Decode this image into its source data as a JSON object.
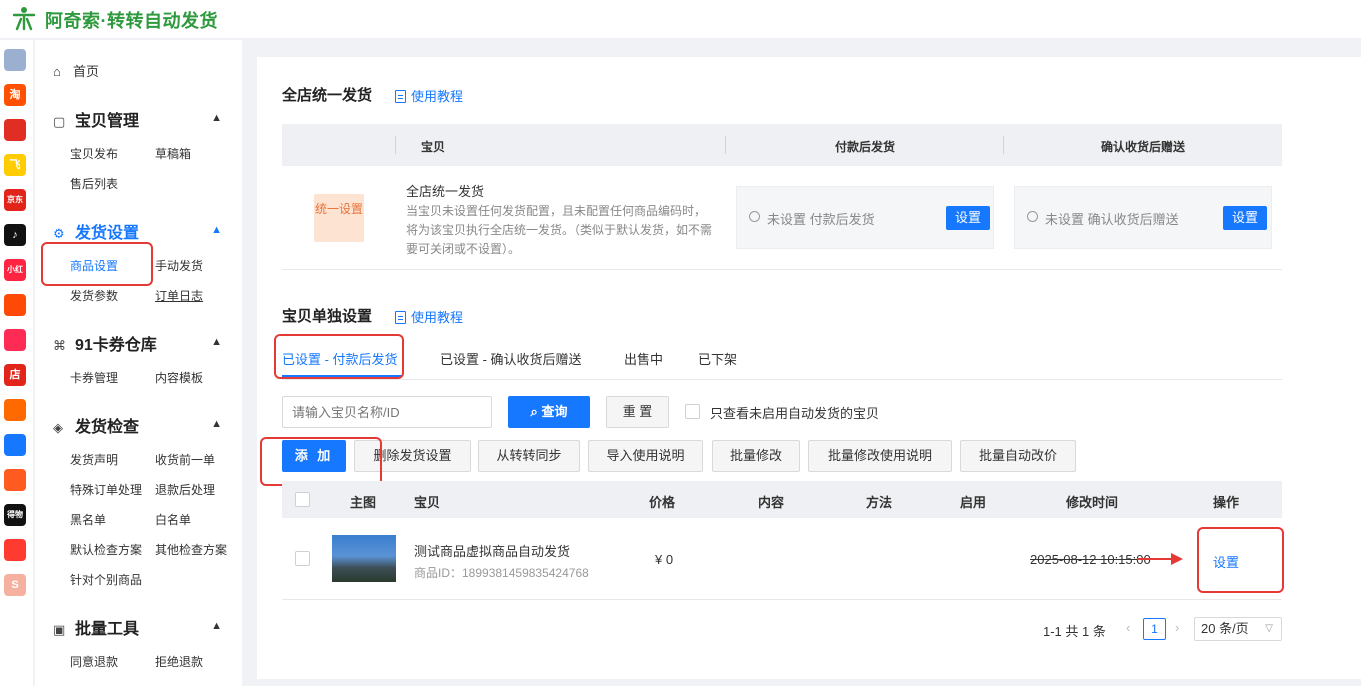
{
  "brand": {
    "name": "阿奇索·转转自动发货"
  },
  "app_stripe": [
    {
      "name": "grid-app-icon",
      "label": "",
      "color": "#9bb0d0"
    },
    {
      "name": "taobao-app-icon",
      "label": "淘",
      "color": "#ff5000"
    },
    {
      "name": "pinduoduo-app-icon",
      "label": "",
      "color": "#e02e24"
    },
    {
      "name": "fliggy-app-icon",
      "label": "飞",
      "color": "#ffcc00"
    },
    {
      "name": "jd-app-icon",
      "label": "京东",
      "color": "#e1251b"
    },
    {
      "name": "douyin-app-icon",
      "label": "♪",
      "color": "#111111"
    },
    {
      "name": "xiaohongshu-app-icon",
      "label": "小红书",
      "color": "#ff2442"
    },
    {
      "name": "kuaishou-app-icon",
      "label": "",
      "color": "#ff4906"
    },
    {
      "name": "thumb-app-icon",
      "label": "",
      "color": "#fe2c55"
    },
    {
      "name": "store-app-icon",
      "label": "店",
      "color": "#e1251b"
    },
    {
      "name": "bag-app-icon",
      "label": "",
      "color": "#ff6a00"
    },
    {
      "name": "link-app-icon",
      "label": "",
      "color": "#1677ff"
    },
    {
      "name": "face-app-icon",
      "label": "",
      "color": "#ff5a1f"
    },
    {
      "name": "dewu-app-icon",
      "label": "得物",
      "color": "#111111"
    },
    {
      "name": "zhuanzhuan-app-icon",
      "label": "",
      "color": "#ff3b30"
    },
    {
      "name": "shop-app-icon",
      "label": "S",
      "color": "#f6b0a0"
    }
  ],
  "sidebar": {
    "home": "首页",
    "groups": [
      {
        "title": "宝贝管理",
        "items": [
          "宝贝发布",
          "草稿箱",
          "售后列表"
        ]
      },
      {
        "title": "发货设置",
        "items": [
          "商品设置",
          "手动发货",
          "发货参数",
          "订单日志"
        ]
      },
      {
        "title": "91卡券仓库",
        "items": [
          "卡券管理",
          "内容模板"
        ]
      },
      {
        "title": "发货检查",
        "items": [
          "发货声明",
          "收货前一单",
          "特殊订单处理",
          "退款后处理",
          "黑名单",
          "白名单",
          "默认检查方案",
          "其他检查方案",
          "针对个别商品"
        ]
      },
      {
        "title": "批量工具",
        "items": [
          "同意退款",
          "拒绝退款"
        ]
      }
    ]
  },
  "store_wide": {
    "title": "全店统一发货",
    "tutorial": "使用教程",
    "columns": [
      "宝贝",
      "付款后发货",
      "确认收货后赠送"
    ],
    "tag": "统一设置",
    "desc_title": "全店统一发货",
    "desc_body": "当宝贝未设置任何发货配置，且未配置任何商品编码时，将为该宝贝执行全店统一发货。（类似于默认发货，如不需要可关闭或不设置）。",
    "after_payment": {
      "status": "未设置 付款后发货",
      "button": "设置"
    },
    "after_receipt": {
      "status": "未设置 确认收货后赠送",
      "button": "设置"
    }
  },
  "single_item": {
    "title": "宝贝单独设置",
    "tutorial": "使用教程",
    "tabs": [
      "已设置 - 付款后发货",
      "已设置 - 确认收货后赠送",
      "出售中",
      "已下架"
    ],
    "search_placeholder": "请输入宝贝名称/ID",
    "query_btn": "查询",
    "reset_btn": "重 置",
    "only_unenabled": "只查看未启用自动发货的宝贝",
    "actions": [
      "添 加",
      "删除发货设置",
      "从转转同步",
      "导入使用说明",
      "批量修改",
      "批量修改使用说明",
      "批量自动改价"
    ],
    "columns": [
      "主图",
      "宝贝",
      "价格",
      "内容",
      "方法",
      "启用",
      "修改时间",
      "操作"
    ],
    "rows": [
      {
        "name": "测试商品虚拟商品自动发货",
        "id": "商品ID：1899381459835424768",
        "price": "¥ 0",
        "content": "",
        "method": "",
        "enabled": "",
        "modified": "2025-08-12 10:15:00",
        "op": "设置"
      }
    ],
    "pagination": {
      "total": "1-1 共 1 条",
      "page": "1",
      "page_size": "20 条/页"
    }
  }
}
